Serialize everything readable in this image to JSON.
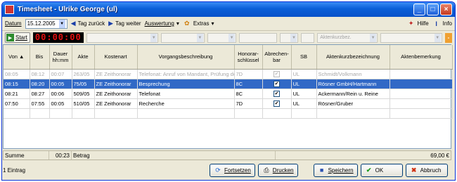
{
  "window": {
    "title": "Timesheet - Ulrike George (ul)"
  },
  "toolbar": {
    "date_label": "Datum",
    "date_value": "15.12.2005",
    "back_label": "Tag zurück",
    "forward_label": "Tag weiter",
    "evaluation_label": "Auswertung",
    "extras_label": "Extras",
    "help_label": "Hilfe",
    "info_label": "Info"
  },
  "timer": {
    "start_label": "Start",
    "display": "00:00:00",
    "filter_placeholder": "Aktenkurzbez."
  },
  "table": {
    "headers": [
      "Von ▲",
      "Bis",
      "Dauer hh:mm",
      "Akte",
      "Kostenart",
      "Vorgangsbeschreibung",
      "Honorar-schlüssel",
      "Abrechen-bar",
      "SB",
      "Aktenkurzbezeichnung",
      "Aktenbemerkung"
    ],
    "rows": [
      {
        "von": "08:05",
        "bis": "08:12",
        "dauer": "00:07",
        "akte": "263/05",
        "kostenart": "ZE Zeithonorar",
        "beschreibung": "Telefonat: Anruf von Mandant, Prüfung der Unterlagen",
        "schluessel": "7D",
        "abrechenbar": "✔",
        "sb": "UL",
        "kurzbez": "Schmidt/Volkmann",
        "bemerkung": ""
      },
      {
        "von": "08:15",
        "bis": "08:20",
        "dauer": "00:05",
        "akte": "75/05",
        "kostenart": "ZE Zeithonorar",
        "beschreibung": "Besprechung",
        "schluessel": "8C",
        "abrechenbar": "✔",
        "sb": "UL",
        "kurzbez": "Rösner GmbH/Hartmann",
        "bemerkung": ""
      },
      {
        "von": "08:21",
        "bis": "08:27",
        "dauer": "00:06",
        "akte": "509/05",
        "kostenart": "ZE Zeithonorar",
        "beschreibung": "Telefonat",
        "schluessel": "8C",
        "abrechenbar": "✔",
        "sb": "UL",
        "kurzbez": "Ackermann/Rein u. Reine",
        "bemerkung": ""
      },
      {
        "von": "07:50",
        "bis": "07:55",
        "dauer": "00:05",
        "akte": "510/05",
        "kostenart": "ZE Zeithonorar",
        "beschreibung": "Recherche",
        "schluessel": "7D",
        "abrechenbar": "✔",
        "sb": "UL",
        "kurzbez": "Rösner/Gruber",
        "bemerkung": ""
      }
    ]
  },
  "summary": {
    "label": "Summe",
    "total_duration": "00:23",
    "betrag_label": "Betrag",
    "amount": "69,00 €"
  },
  "status": {
    "entries": "1 Eintrag"
  },
  "buttons": {
    "continue": "Fortsetzen",
    "print": "Drucken",
    "save": "Speichern",
    "ok": "OK",
    "cancel": "Abbruch"
  }
}
